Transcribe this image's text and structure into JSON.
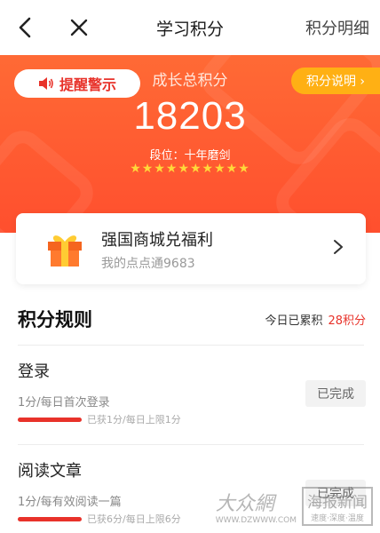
{
  "topbar": {
    "title": "学习积分",
    "detail_label": "积分明细"
  },
  "hero": {
    "remind_label": "提醒警示",
    "explain_label": "积分说明 ›",
    "score_label": "成长总积分",
    "score": "18203",
    "rank": "段位：十年磨剑",
    "stars": "★★★★★★★★★★",
    "star_count": 10
  },
  "mall_card": {
    "title": "强国商城兑福利",
    "subtitle": "我的点点通9683"
  },
  "rules": {
    "heading": "积分规则",
    "today_label": "今日已累积",
    "today_points": "28积分",
    "items": [
      {
        "name": "登录",
        "desc": "1分/每日首次登录",
        "progress_text": "已获1分/每日上限1分",
        "progress": 1.0,
        "status": "已完成"
      },
      {
        "name": "阅读文章",
        "desc": "1分/每有效阅读一篇",
        "progress_text": "已获6分/每日上限6分",
        "progress": 1.0,
        "status": "已完成"
      }
    ]
  },
  "watermark": {
    "text": "大众網",
    "site": "海报新闻",
    "tagline": "速度·深度·温度",
    "url": "WWW.DZWWW.COM"
  },
  "colors": {
    "brand_red": "#e8322a",
    "hero_orange": "#ff5a30",
    "explain_yellow": "#ffb014",
    "star_yellow": "#ffd83a"
  }
}
